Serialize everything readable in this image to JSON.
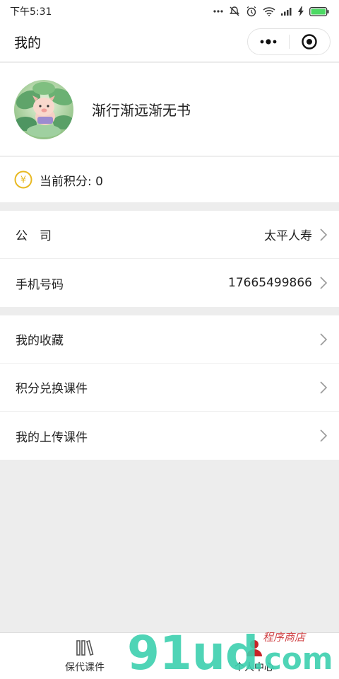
{
  "status_bar": {
    "time": "下午5:31"
  },
  "nav": {
    "title": "我的"
  },
  "profile": {
    "username": "渐行渐远渐无书"
  },
  "points": {
    "label": "当前积分: 0",
    "currency_symbol": "¥"
  },
  "info_rows": [
    {
      "label": "公　司",
      "value": "太平人寿"
    },
    {
      "label": "手机号码",
      "value": "17665499866"
    }
  ],
  "menu_rows": [
    {
      "label": "我的收藏"
    },
    {
      "label": "积分兑换课件"
    },
    {
      "label": "我的上传课件"
    }
  ],
  "tabs": [
    {
      "label": "保代课件",
      "icon": "books-icon"
    },
    {
      "label": "个人中心",
      "icon": "user-icon"
    }
  ],
  "watermark": {
    "digits": "91ud",
    "domain": ".com",
    "shop": "程序商店"
  },
  "colors": {
    "accent_gold": "#e8b923",
    "watermark_green": "#3ccfae",
    "watermark_red": "#c82327"
  }
}
